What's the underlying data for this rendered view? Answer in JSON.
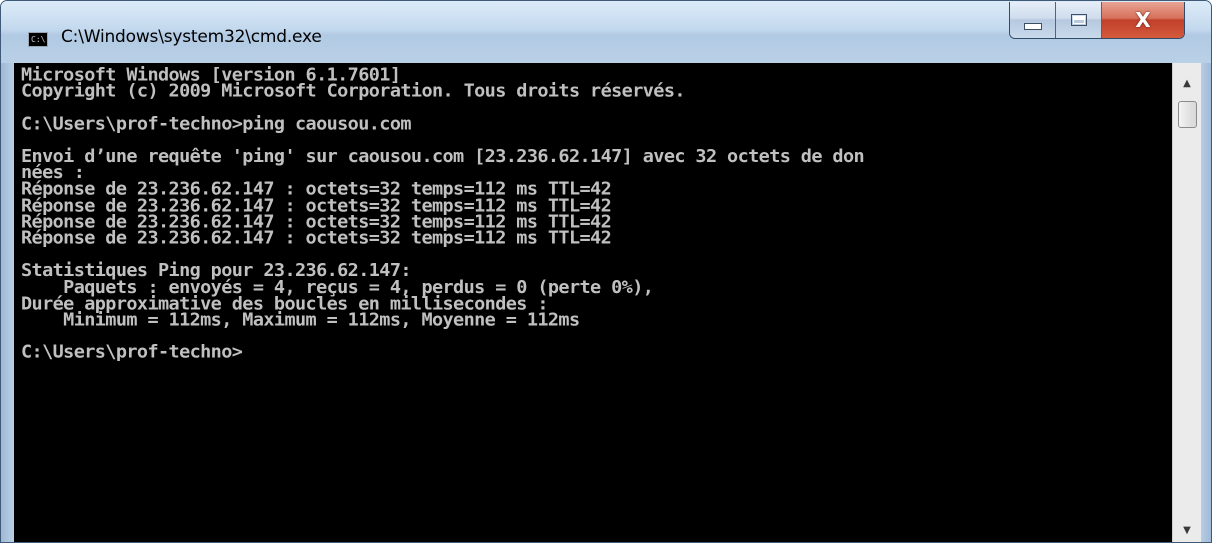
{
  "window": {
    "title": "C:\\Windows\\system32\\cmd.exe",
    "icon_label": "C:\\",
    "icon": "cmd-icon",
    "buttons": {
      "minimize": "minimize-icon",
      "maximize": "maximize-icon",
      "close": "close-icon",
      "close_glyph": "X"
    }
  },
  "console": {
    "foreground": "#c0c0c0",
    "background": "#000000",
    "lines": [
      "Microsoft Windows [version 6.1.7601]",
      "Copyright (c) 2009 Microsoft Corporation. Tous droits réservés.",
      "",
      "C:\\Users\\prof-techno>ping caousou.com",
      "",
      "Envoi d’une requête 'ping' sur caousou.com [23.236.62.147] avec 32 octets de don",
      "nées :",
      "Réponse de 23.236.62.147 : octets=32 temps=112 ms TTL=42",
      "Réponse de 23.236.62.147 : octets=32 temps=112 ms TTL=42",
      "Réponse de 23.236.62.147 : octets=32 temps=112 ms TTL=42",
      "Réponse de 23.236.62.147 : octets=32 temps=112 ms TTL=42",
      "",
      "Statistiques Ping pour 23.236.62.147:",
      "    Paquets : envoyés = 4, reçus = 4, perdus = 0 (perte 0%),",
      "Durée approximative des boucles en millisecondes :",
      "    Minimum = 112ms, Maximum = 112ms, Moyenne = 112ms",
      "",
      "C:\\Users\\prof-techno>"
    ]
  },
  "scrollbar": {
    "up_arrow": "▲",
    "down_arrow": "▼",
    "position": 0
  }
}
